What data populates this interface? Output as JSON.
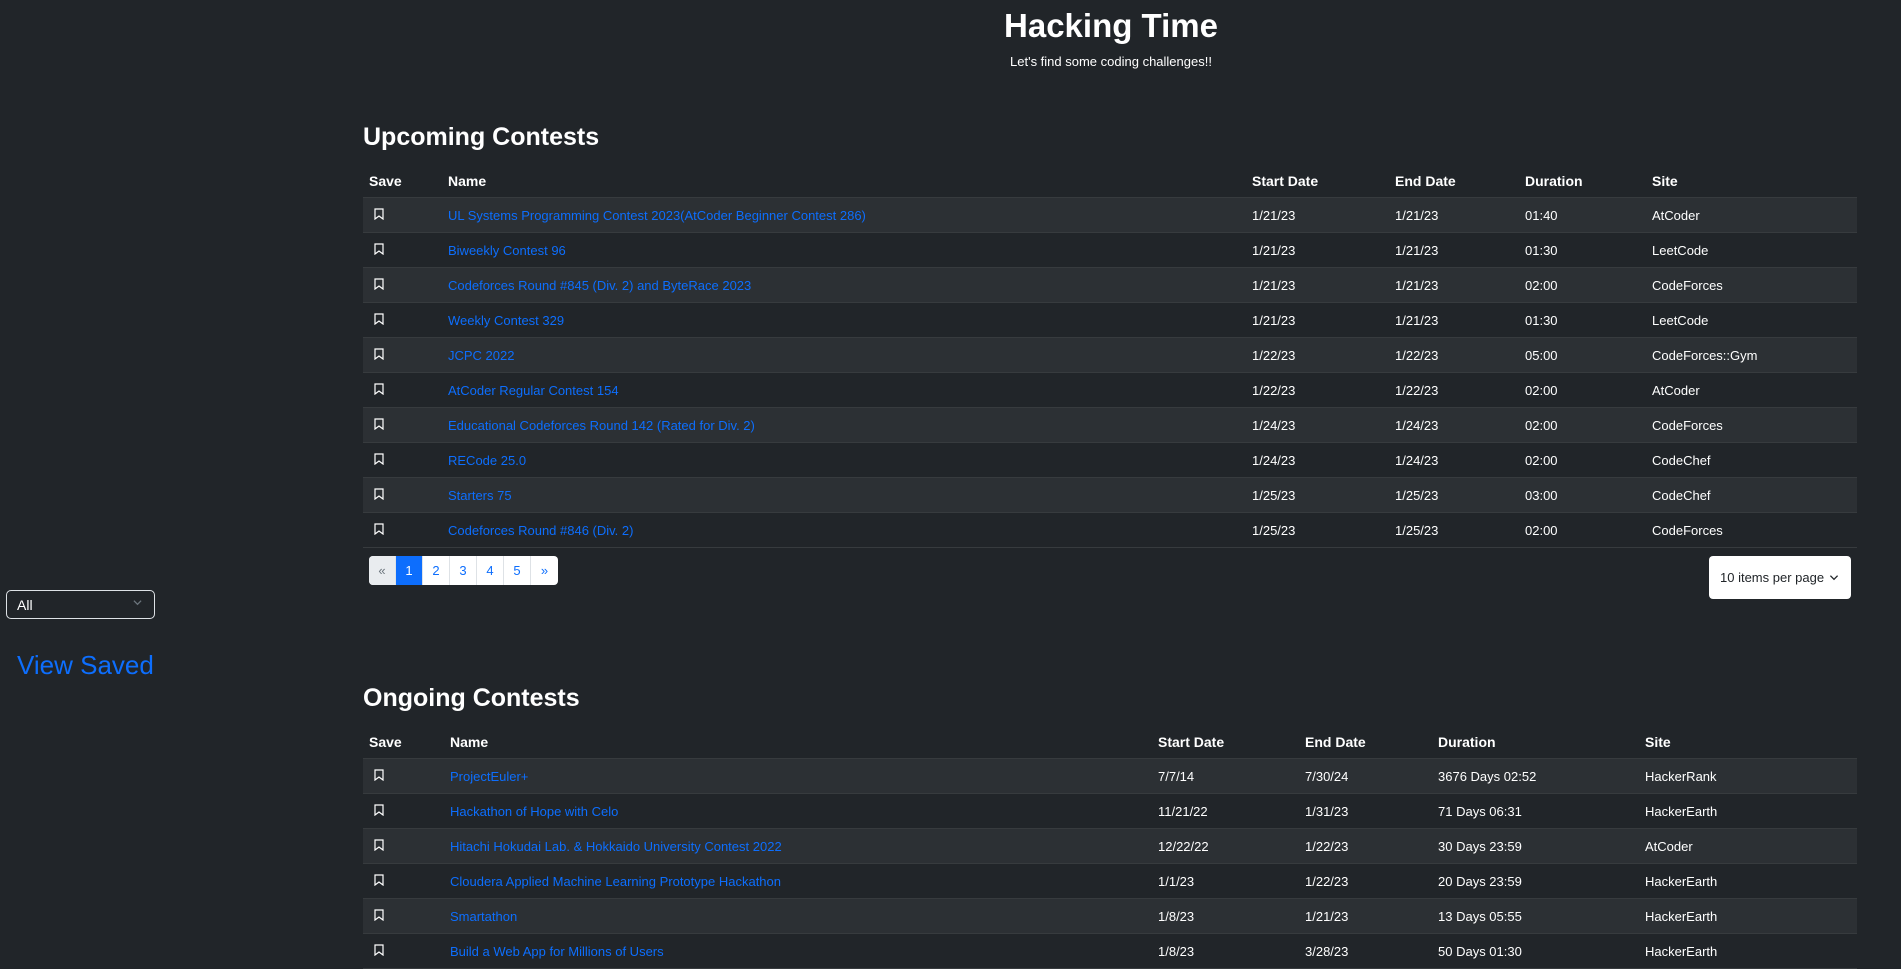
{
  "header": {
    "title": "Hacking Time",
    "subtitle": "Let's find some coding challenges!!"
  },
  "sidebar": {
    "filter_value": "All",
    "view_saved": "View Saved"
  },
  "upcoming": {
    "title": "Upcoming Contests",
    "columns": [
      "Save",
      "Name",
      "Start Date",
      "End Date",
      "Duration",
      "Site"
    ],
    "rows": [
      {
        "name": "UL Systems Programming Contest 2023(AtCoder Beginner Contest 286)",
        "start": "1/21/23",
        "end": "1/21/23",
        "duration": "01:40",
        "site": "AtCoder"
      },
      {
        "name": "Biweekly Contest 96",
        "start": "1/21/23",
        "end": "1/21/23",
        "duration": "01:30",
        "site": "LeetCode"
      },
      {
        "name": "Codeforces Round #845 (Div. 2) and ByteRace 2023",
        "start": "1/21/23",
        "end": "1/21/23",
        "duration": "02:00",
        "site": "CodeForces"
      },
      {
        "name": "Weekly Contest 329",
        "start": "1/21/23",
        "end": "1/21/23",
        "duration": "01:30",
        "site": "LeetCode"
      },
      {
        "name": "JCPC 2022",
        "start": "1/22/23",
        "end": "1/22/23",
        "duration": "05:00",
        "site": "CodeForces::Gym"
      },
      {
        "name": "AtCoder Regular Contest 154",
        "start": "1/22/23",
        "end": "1/22/23",
        "duration": "02:00",
        "site": "AtCoder"
      },
      {
        "name": "Educational Codeforces Round 142 (Rated for Div. 2)",
        "start": "1/24/23",
        "end": "1/24/23",
        "duration": "02:00",
        "site": "CodeForces"
      },
      {
        "name": "RECode 25.0",
        "start": "1/24/23",
        "end": "1/24/23",
        "duration": "02:00",
        "site": "CodeChef"
      },
      {
        "name": "Starters 75",
        "start": "1/25/23",
        "end": "1/25/23",
        "duration": "03:00",
        "site": "CodeChef"
      },
      {
        "name": "Codeforces Round #846 (Div. 2)",
        "start": "1/25/23",
        "end": "1/25/23",
        "duration": "02:00",
        "site": "CodeForces"
      }
    ]
  },
  "pagination": {
    "prev": "«",
    "pages": [
      "1",
      "2",
      "3",
      "4",
      "5"
    ],
    "active": "1",
    "next": "»"
  },
  "per_page": {
    "label": "10 items per page"
  },
  "ongoing": {
    "title": "Ongoing Contests",
    "columns": [
      "Save",
      "Name",
      "Start Date",
      "End Date",
      "Duration",
      "Site"
    ],
    "rows": [
      {
        "name": "ProjectEuler+",
        "start": "7/7/14",
        "end": "7/30/24",
        "duration": "3676 Days 02:52",
        "site": "HackerRank"
      },
      {
        "name": "Hackathon of Hope with Celo",
        "start": "11/21/22",
        "end": "1/31/23",
        "duration": "71 Days 06:31",
        "site": "HackerEarth"
      },
      {
        "name": "Hitachi Hokudai Lab. & Hokkaido University Contest 2022",
        "start": "12/22/22",
        "end": "1/22/23",
        "duration": "30 Days 23:59",
        "site": "AtCoder"
      },
      {
        "name": "Cloudera Applied Machine Learning Prototype Hackathon",
        "start": "1/1/23",
        "end": "1/22/23",
        "duration": "20 Days 23:59",
        "site": "HackerEarth"
      },
      {
        "name": "Smartathon",
        "start": "1/8/23",
        "end": "1/21/23",
        "duration": "13 Days 05:55",
        "site": "HackerEarth"
      },
      {
        "name": "Build a Web App for Millions of Users",
        "start": "1/8/23",
        "end": "3/28/23",
        "duration": "50 Days 01:30",
        "site": "HackerEarth"
      }
    ]
  }
}
